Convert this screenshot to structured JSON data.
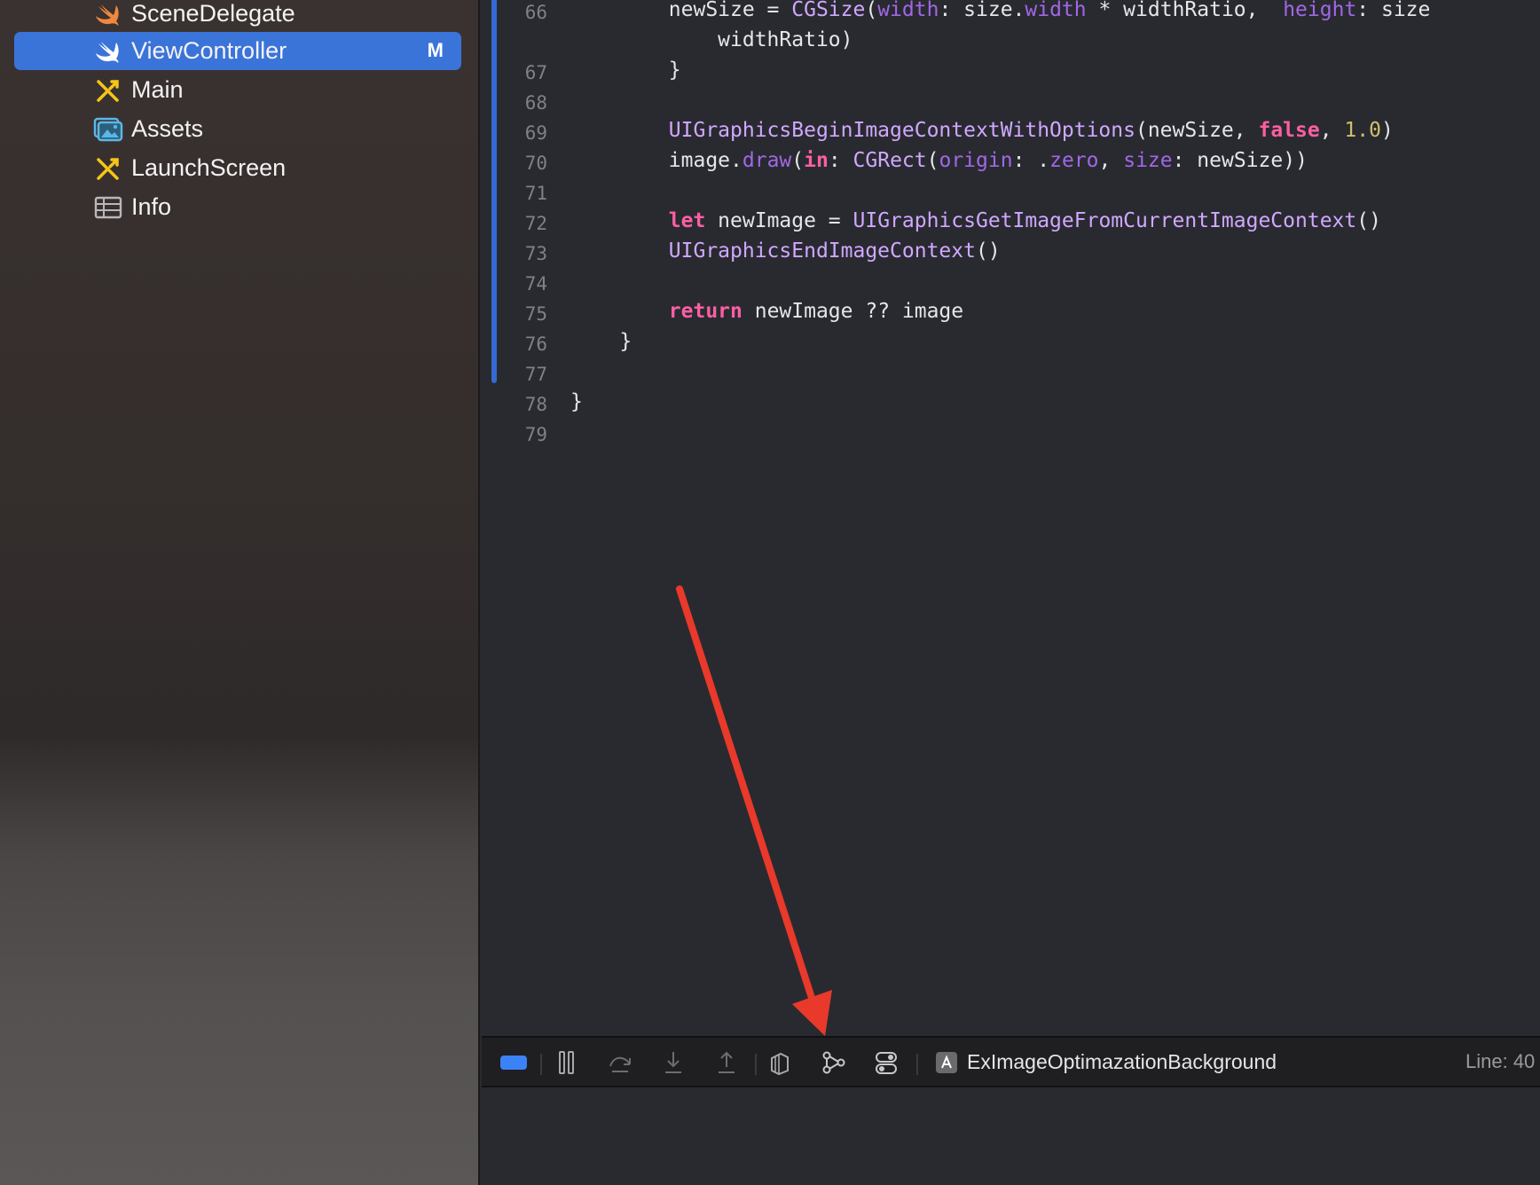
{
  "navigator": {
    "items": [
      {
        "label": "SceneDelegate",
        "icon": "swift-icon",
        "badge": ""
      },
      {
        "label": "ViewController",
        "icon": "swift-icon",
        "badge": "M"
      },
      {
        "label": "Main",
        "icon": "storyboard-icon",
        "badge": ""
      },
      {
        "label": "Assets",
        "icon": "asset-catalog-icon",
        "badge": ""
      },
      {
        "label": "LaunchScreen",
        "icon": "storyboard-icon",
        "badge": ""
      },
      {
        "label": "Info",
        "icon": "plist-icon",
        "badge": ""
      }
    ]
  },
  "editor": {
    "lines": [
      {
        "num": "66",
        "text": "        newSize = CGSize(width: size.width * widthRatio,  height: size"
      },
      {
        "num": "",
        "text": "            widthRatio)"
      },
      {
        "num": "67",
        "text": "        }"
      },
      {
        "num": "68",
        "text": ""
      },
      {
        "num": "69",
        "text": "        UIGraphicsBeginImageContextWithOptions(newSize, false, 1.0)"
      },
      {
        "num": "70",
        "text": "        image.draw(in: CGRect(origin: .zero, size: newSize))"
      },
      {
        "num": "71",
        "text": ""
      },
      {
        "num": "72",
        "text": "        let newImage = UIGraphicsGetImageFromCurrentImageContext()"
      },
      {
        "num": "73",
        "text": "        UIGraphicsEndImageContext()"
      },
      {
        "num": "74",
        "text": ""
      },
      {
        "num": "75",
        "text": "        return newImage ?? image"
      },
      {
        "num": "76",
        "text": "    }"
      },
      {
        "num": "77",
        "text": ""
      },
      {
        "num": "78",
        "text": "}"
      },
      {
        "num": "79",
        "text": ""
      }
    ]
  },
  "debug_bar": {
    "target_name": "ExImageOptimazationBackground",
    "line_indicator": "Line: 40"
  },
  "colors": {
    "selection": "#3b74d9",
    "keyword": "#fc5fa3",
    "type": "#d0a8ff",
    "annotation_arrow": "#e8392a"
  }
}
